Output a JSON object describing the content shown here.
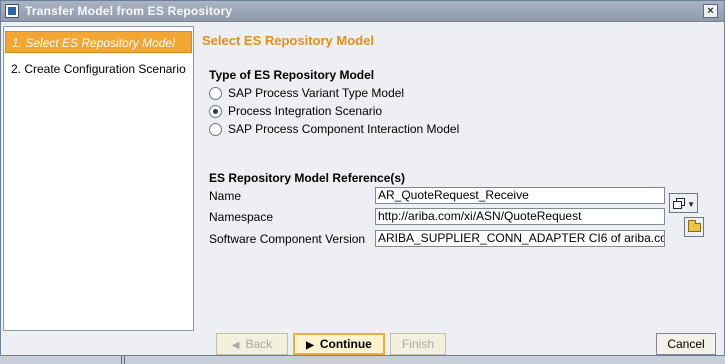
{
  "window": {
    "title": "Transfer Model from ES Repository",
    "close_glyph": "×"
  },
  "sidebar": {
    "steps": [
      {
        "label": "1. Select ES Repository Model",
        "active": true
      },
      {
        "label": "2. Create Configuration Scenario",
        "active": false
      }
    ]
  },
  "main": {
    "heading": "Select ES Repository Model",
    "model_type": {
      "label": "Type of ES Repository Model",
      "options": [
        {
          "label": "SAP Process Variant Type Model",
          "checked": false
        },
        {
          "label": "Process Integration Scenario",
          "checked": true
        },
        {
          "label": "SAP Process Component Interaction Model",
          "checked": false
        }
      ]
    },
    "reference": {
      "label": "ES Repository Model Reference(s)",
      "name_label": "Name",
      "name_value": "AR_QuoteRequest_Receive",
      "namespace_label": "Namespace",
      "namespace_value": "http://ariba.com/xi/ASN/QuoteRequest",
      "swcv_label": "Software Component Version",
      "swcv_value": "ARIBA_SUPPLIER_CONN_ADAPTER CI6 of ariba.co"
    }
  },
  "buttons": {
    "back": "Back",
    "continue": "Continue",
    "finish": "Finish",
    "cancel": "Cancel"
  },
  "icons": {
    "back_glyph": "◀",
    "continue_glyph": "▶",
    "browse_caret": "▼"
  },
  "colors": {
    "accent": "#f2a633",
    "heading": "#e58e1b"
  }
}
